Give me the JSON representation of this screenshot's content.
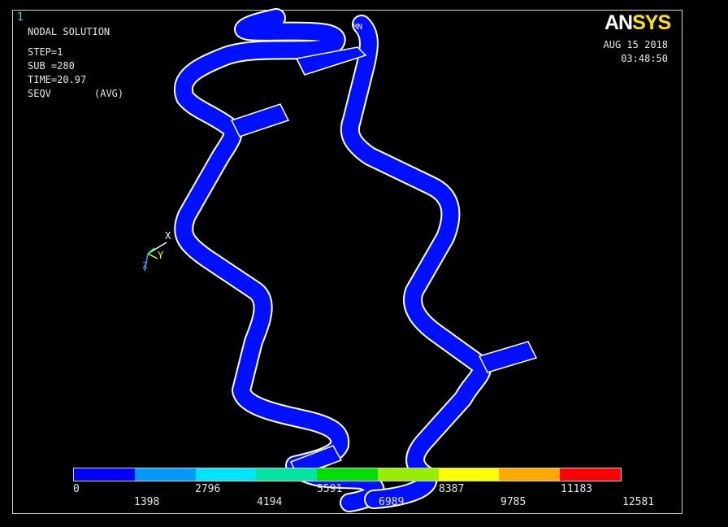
{
  "window_number": "1",
  "info": {
    "line1": "NODAL SOLUTION",
    "line2": "STEP=1",
    "line3": "SUB =280",
    "line4": "TIME=20.97",
    "line5_key": "SEQV",
    "line5_val": "(AVG)"
  },
  "logo": {
    "part1": "AN",
    "part2": "SYS"
  },
  "date": "AUG 15 2018",
  "time": "03:48:50",
  "mn_label": "MN",
  "triad": {
    "x": "X",
    "y": "Y",
    "z": "Z"
  },
  "legend": {
    "colors": [
      "#0000ff",
      "#0099ff",
      "#00e5ff",
      "#00e5a0",
      "#00dd00",
      "#99ee00",
      "#ffff00",
      "#ffaa00",
      "#ff0000"
    ],
    "labels_top": [
      "0",
      "2796",
      "5591",
      "8387",
      "11183"
    ],
    "labels_bottom": [
      "1398",
      "4194",
      "6989",
      "9785",
      "12581"
    ]
  },
  "colors": {
    "structure": "#0010ff",
    "edge": "#ffffff"
  }
}
